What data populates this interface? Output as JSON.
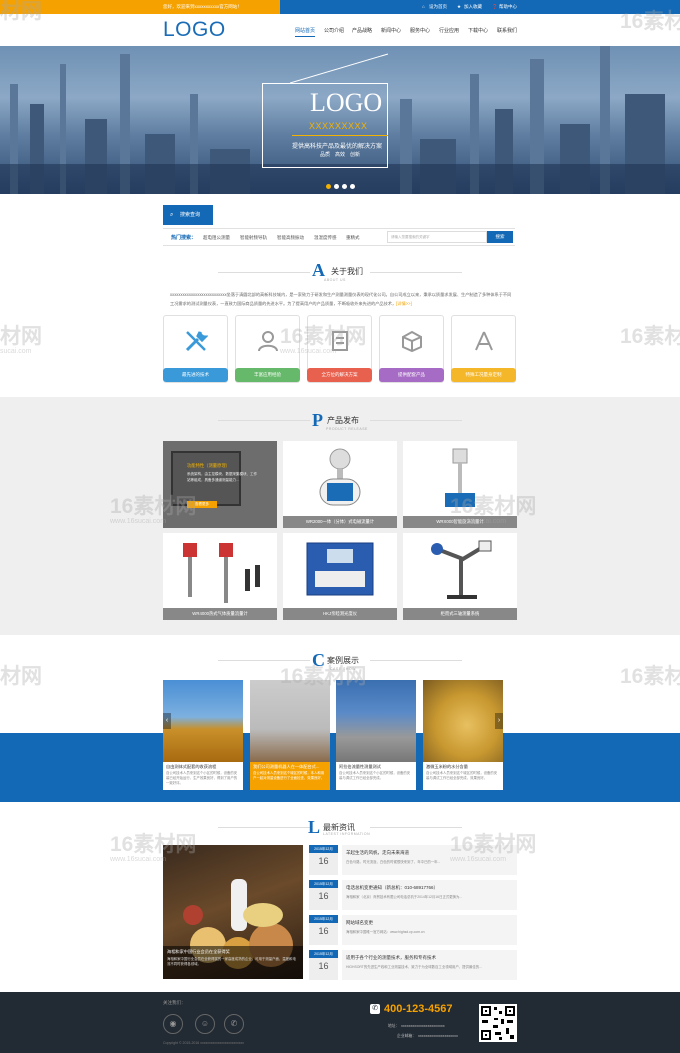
{
  "topbar": {
    "welcome": "您好，欢迎来到xxxxxxxxxxx官方网站！",
    "home": "设为首页",
    "favorite": "加入收藏",
    "help": "帮助中心"
  },
  "header": {
    "logo": "LOGO",
    "nav": [
      "网站首页",
      "公司介绍",
      "产品战略",
      "新闻中心",
      "服务中心",
      "行业应用",
      "下载中心",
      "联系我们"
    ]
  },
  "banner": {
    "logo": "LOGO",
    "sub": "XXXXXXXXX",
    "slogan": "提供高科技产品及最优的解决方案",
    "tags": [
      "品质",
      "高效",
      "创新"
    ],
    "dots": 4,
    "active_dot": 0
  },
  "search": {
    "tab": "搜索查询",
    "hot_label": "热门搜索：",
    "keywords": [
      "超电阻公测量",
      "智能射频导轨",
      "智能高频振动",
      "温湿度传感",
      "重精式"
    ],
    "placeholder": "请输入您要搜索的关键字",
    "button": "搜索"
  },
  "about": {
    "letter": "A",
    "title": "关于我们",
    "subtitle": "ABOUT US",
    "text": "xxxxxxxxxxxxxxxxxxxxxxxxxxx坐落于清圆北部的高新科技城内，是一家致力于研发和生产测量测量仪表的现代化公司。自公司成立以来，秉承以质量求发展、生产制造了多种体系于不同工况需求的测试测量仪表，一直致力国际商品质量的先进水平。为了提高用户的产品质量，不断吸收外来先进的产品技术，",
    "more": "[详情>>]",
    "cards": [
      {
        "label": "最先进的技术",
        "icon": "tools-icon",
        "color": "#3a9ad9"
      },
      {
        "label": "丰富应用经验",
        "icon": "user-icon",
        "color": "#66b96a"
      },
      {
        "label": "全方位的解决方案",
        "icon": "document-icon",
        "color": "#e8614f"
      },
      {
        "label": "提供配套产品",
        "icon": "box-icon",
        "color": "#a66bc4"
      },
      {
        "label": "特殊工况量身定制",
        "icon": "compass-icon",
        "color": "#f5b72a"
      }
    ]
  },
  "products": {
    "letter": "P",
    "title": "产品发布",
    "subtitle": "PRODUCT RELEASE",
    "featured": {
      "title": "功能特性（测量原理）",
      "desc": "系统架构，由主控模块、数据采集模块、工作站等组成，具备多通道测量能力…",
      "button": "查看更多"
    },
    "items": [
      {
        "caption": ""
      },
      {
        "caption": "WR2000一体（分体）式电磁流量计"
      },
      {
        "caption": "WRX000智能旋涡流量计"
      },
      {
        "caption": "WR4000热式气体质量流量计"
      },
      {
        "caption": "HKJ亲睦测光度仪"
      },
      {
        "caption": "柜而式三轴测量系统"
      }
    ]
  },
  "cases": {
    "letter": "C",
    "title": "案例展示",
    "subtitle": "CASE SHOW",
    "items": [
      {
        "title": "自由测体式配套的收获流程",
        "desc": "自公司技术人员来到这个小区的时候，设备的安装已经开始运行，生产效果良好，得到了用户的一致好评。"
      },
      {
        "title": "我们公司测量机器人在一体配台式...",
        "desc": "自公司技术人员来到这个城区的时候，本人和用户一起对测量设备进行了全面检查，效果良好。"
      },
      {
        "title": "阿拉伯流量性测量测试",
        "desc": "自公司技术人员来到这个小区的时候，设备的安装与调试工作已经全部完成。"
      },
      {
        "title": "激微玉米粉的水分含量",
        "desc": "自公司技术人员来到这个城区的时候，设备的安装与调试工作已经全部完成，效果良好。"
      }
    ]
  },
  "news": {
    "letter": "L",
    "title": "最新资讯",
    "subtitle": "LATEST INFORMATION",
    "featured": {
      "title": "海相和家中国行业会员在全获得奖",
      "desc": "海相和家中国行业会员在全获得奖的一家高度成熟的企业，可用于测量户面、温度和电流不同时获得各领域。"
    },
    "items": [
      {
        "ym": "2015年12月",
        "day": "16",
        "title": "羊起生活的风帆，走向未来海道",
        "desc": "白色马路，时光流逝，白色的时候很快来到了，年中已的一年..."
      },
      {
        "ym": "2015年12月",
        "day": "16",
        "title": "电话总机变更通知（新总机：010-68917766）",
        "desc": "海相和家（北京）商贸技术有限公司电话总机于2014年12月16日正式更换为..."
      },
      {
        "ym": "2015年12月",
        "day": "16",
        "title": "网站域名变更",
        "desc": "海相和家中国唯一官方网站：www.highsd.cp.com.cn"
      },
      {
        "ym": "2015年12月",
        "day": "16",
        "title": "适用于各个行业的测量技术，服务和专有技术",
        "desc": "HIGHSORT的先进生产线和工业测量技术，致力于为全球数百工业领域用户，提供最佳的..."
      }
    ]
  },
  "footer": {
    "follow": "关注我们：",
    "copyright": "Copyright © 2015-2016 xxxxxxxxxxxxxxxxxxxxxxxxx",
    "phone": "400-123-4567",
    "address_label": "地址：",
    "address": "xxxxxxxxxxxxxxxxxxxxxxx",
    "email_label": "企业邮箱：",
    "email": "xxxxxxxxxxxxxxxxxxxxx"
  },
  "watermark": {
    "text": "16素材网",
    "url": "www.16sucai.com",
    "short": "材网",
    "short_url": "sucai.com"
  },
  "colors": {
    "brand": "#1469b6",
    "accent": "#f5a100",
    "footer": "#222a33"
  }
}
